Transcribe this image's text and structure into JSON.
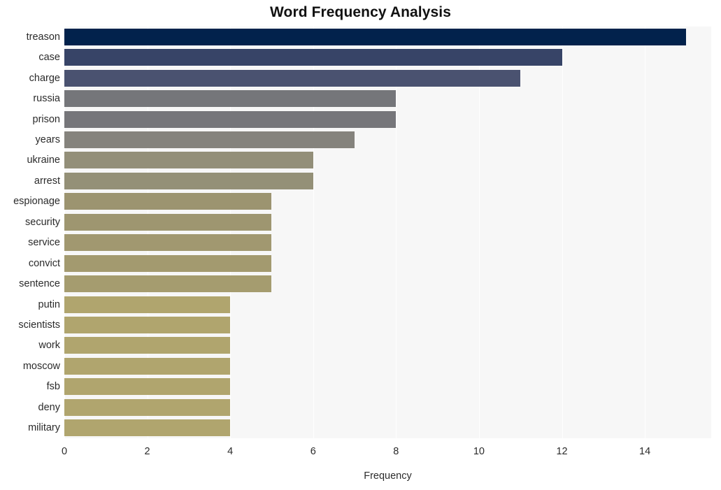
{
  "chart_data": {
    "type": "bar",
    "orientation": "horizontal",
    "title": "Word Frequency Analysis",
    "xlabel": "Frequency",
    "ylabel": "",
    "categories": [
      "treason",
      "case",
      "charge",
      "russia",
      "prison",
      "years",
      "ukraine",
      "arrest",
      "espionage",
      "security",
      "service",
      "convict",
      "sentence",
      "putin",
      "scientists",
      "work",
      "moscow",
      "fsb",
      "deny",
      "military"
    ],
    "values": [
      15,
      12,
      11,
      8,
      8,
      7,
      6,
      6,
      5,
      5,
      5,
      5,
      5,
      4,
      4,
      4,
      4,
      4,
      4,
      4
    ],
    "bar_colors": [
      "#02224c",
      "#374467",
      "#4a5270",
      "#75767a",
      "#76767a",
      "#85837d",
      "#938f79",
      "#949077",
      "#9c9470",
      "#9e9670",
      "#a19870",
      "#a39a6f",
      "#a59c6f",
      "#b0a56e",
      "#b0a56e",
      "#b0a56e",
      "#b0a56e",
      "#b0a56e",
      "#b0a56e",
      "#b0a56e"
    ],
    "xticks": [
      0,
      2,
      4,
      6,
      8,
      10,
      12,
      14
    ],
    "xlim": [
      0,
      15.6
    ],
    "ylim_count": 20,
    "grid": true,
    "grid_axis": "x",
    "grid_color": "#ffffff",
    "plot_background": "#f7f7f7",
    "figure_background": "#ffffff",
    "legend": null
  }
}
